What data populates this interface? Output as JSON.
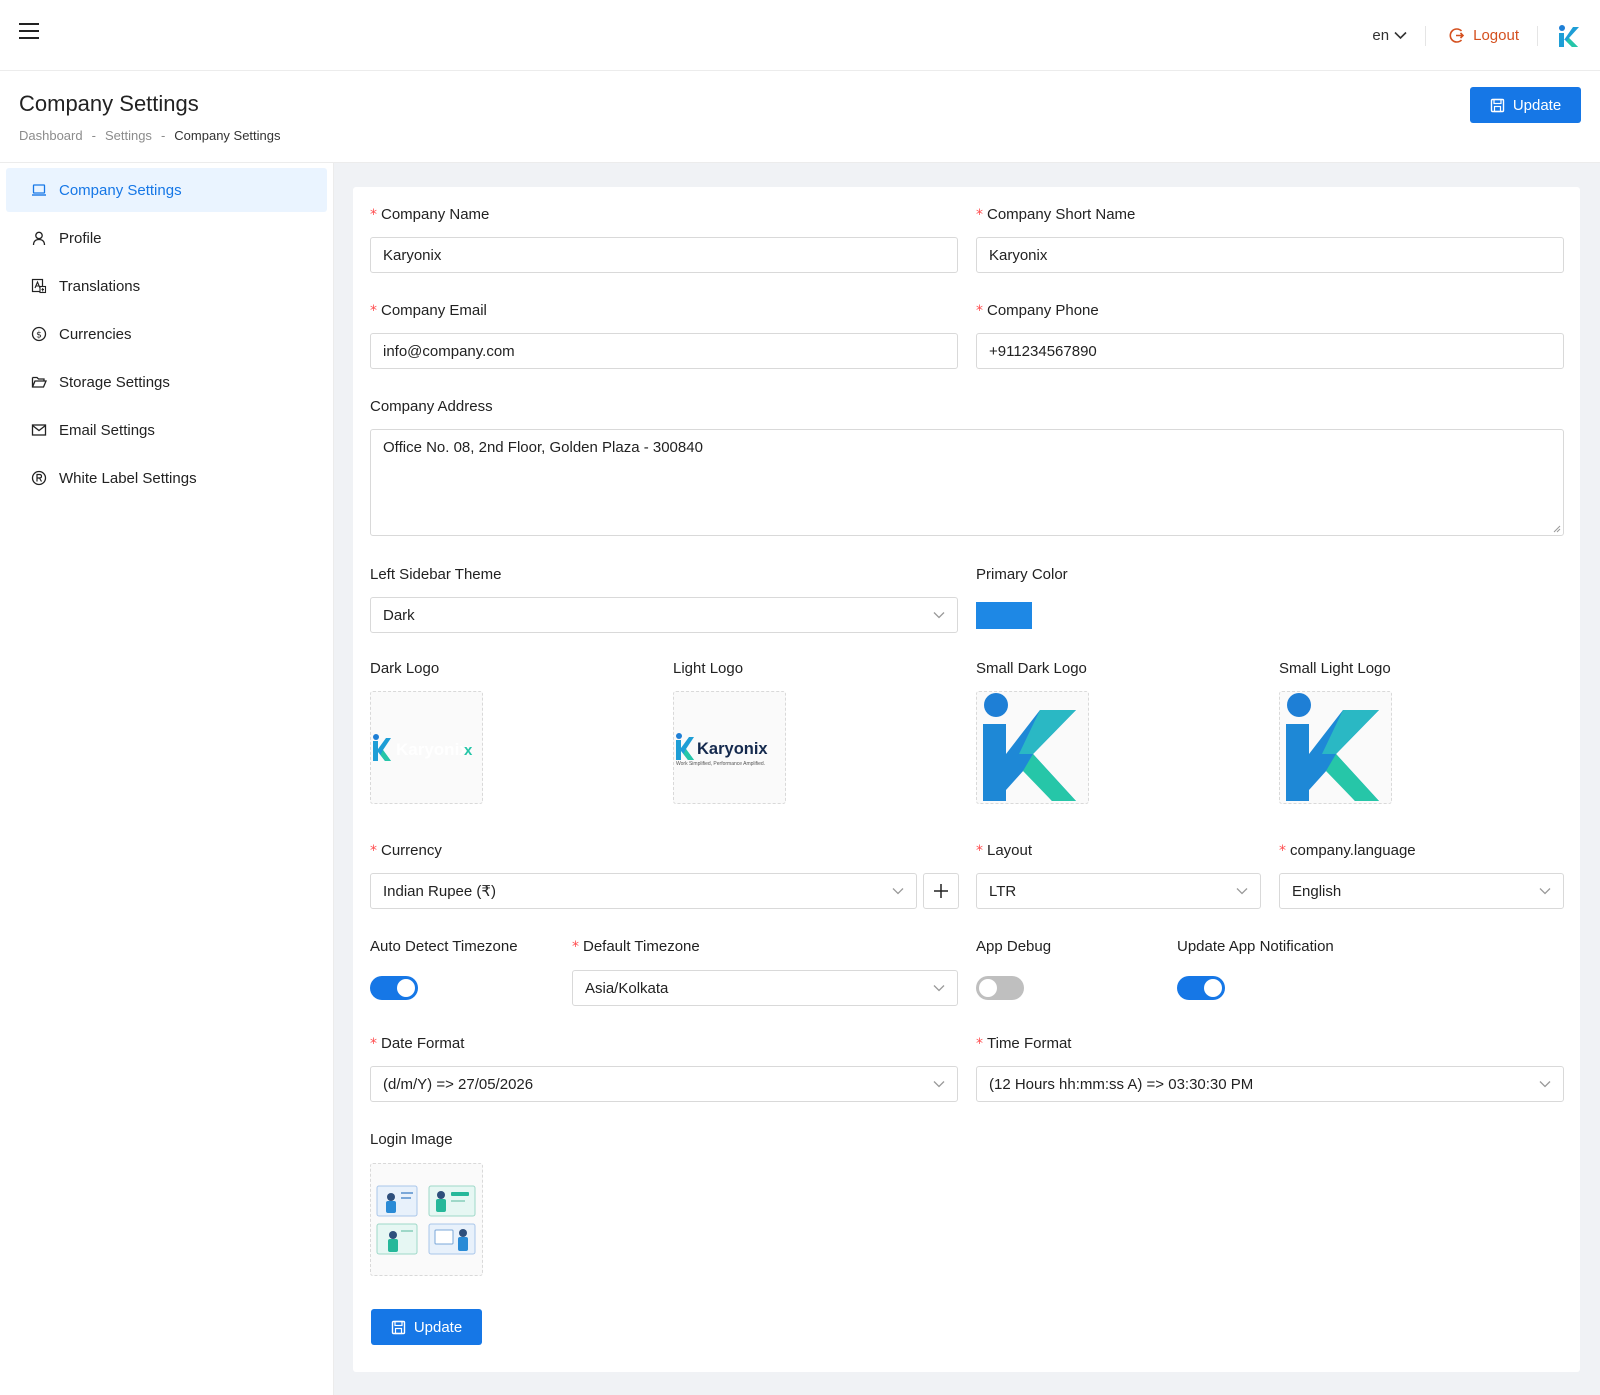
{
  "topbar": {
    "language": "en",
    "logout_label": "Logout"
  },
  "header": {
    "title": "Company Settings",
    "breadcrumb": [
      "Dashboard",
      "Settings",
      "Company Settings"
    ],
    "update_label": "Update"
  },
  "sidebar": {
    "items": [
      {
        "label": "Company Settings",
        "icon": "laptop-icon",
        "active": true
      },
      {
        "label": "Profile",
        "icon": "user-icon"
      },
      {
        "label": "Translations",
        "icon": "translate-icon"
      },
      {
        "label": "Currencies",
        "icon": "dollar-circle-icon"
      },
      {
        "label": "Storage Settings",
        "icon": "folder-open-icon"
      },
      {
        "label": "Email Settings",
        "icon": "mail-icon"
      },
      {
        "label": "White Label Settings",
        "icon": "registered-icon"
      }
    ]
  },
  "form": {
    "company_name": {
      "label": "Company Name",
      "value": "Karyonix"
    },
    "company_short_name": {
      "label": "Company Short Name",
      "value": "Karyonix"
    },
    "company_email": {
      "label": "Company Email",
      "value": "info@company.com"
    },
    "company_phone": {
      "label": "Company Phone",
      "value": "+911234567890"
    },
    "company_address": {
      "label": "Company Address",
      "value": "Office No. 08, 2nd Floor, Golden Plaza - 300840"
    },
    "left_sidebar_theme": {
      "label": "Left Sidebar Theme",
      "value": "Dark"
    },
    "primary_color": {
      "label": "Primary Color",
      "value": "#1e88e5"
    },
    "logos": {
      "dark_logo": "Dark Logo",
      "light_logo": "Light Logo",
      "small_dark_logo": "Small Dark Logo",
      "small_light_logo": "Small Light Logo",
      "logo_text": "Karyonix",
      "logo_tagline": "Work Simplified, Performance Amplified."
    },
    "currency": {
      "label": "Currency",
      "value": "Indian Rupee (₹)"
    },
    "layout": {
      "label": "Layout",
      "value": "LTR"
    },
    "language": {
      "label": "company.language",
      "value": "English"
    },
    "auto_detect_timezone": {
      "label": "Auto Detect Timezone",
      "on": true
    },
    "default_timezone": {
      "label": "Default Timezone",
      "value": "Asia/Kolkata"
    },
    "app_debug": {
      "label": "App Debug",
      "on": false
    },
    "update_app_notification": {
      "label": "Update App Notification",
      "on": true
    },
    "date_format": {
      "label": "Date Format",
      "value": "(d/m/Y) => 27/05/2026"
    },
    "time_format": {
      "label": "Time Format",
      "value": "(12 Hours hh:mm:ss A) => 03:30:30 PM"
    },
    "login_image": {
      "label": "Login Image"
    },
    "update_label": "Update"
  },
  "colors": {
    "accent": "#1677e6",
    "logout": "#d4501f",
    "required": "#ff4d4f"
  }
}
